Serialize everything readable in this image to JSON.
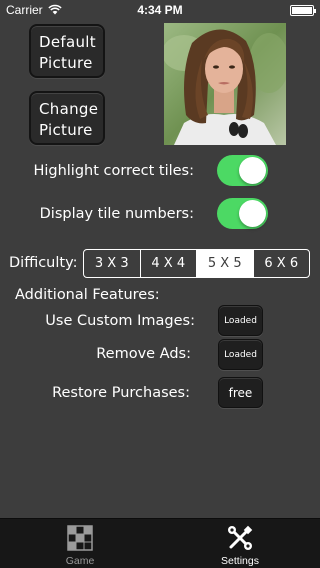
{
  "status_bar": {
    "carrier": "Carrier",
    "time": "4:34 PM"
  },
  "picture_buttons": {
    "default_line1": "Default",
    "default_line2": "Picture",
    "change_line1": "Change",
    "change_line2": "Picture"
  },
  "preview": {
    "icon": "portrait-photo"
  },
  "toggles": {
    "highlight_label": "Highlight correct tiles:",
    "highlight_on": true,
    "numbers_label": "Display tile numbers:",
    "numbers_on": true,
    "on_color": "#4cd964"
  },
  "difficulty": {
    "label": "Difficulty:",
    "options": [
      "3 X 3",
      "4 X 4",
      "5 X 5",
      "6 X 6"
    ],
    "selected": "5 X 5"
  },
  "additional": {
    "heading": "Additional Features:",
    "custom_label": "Use Custom Images:",
    "custom_button": "Loaded",
    "ads_label": "Remove Ads:",
    "ads_button": "Loaded",
    "restore_label": "Restore Purchases:",
    "restore_button": "free"
  },
  "tab_bar": {
    "game_label": "Game",
    "game_icon": "grid-puzzle-icon",
    "settings_label": "Settings",
    "settings_icon": "tools-icon",
    "active": "Settings"
  }
}
